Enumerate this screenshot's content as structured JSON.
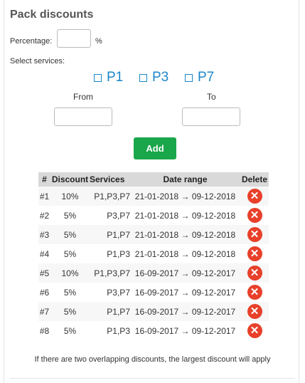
{
  "title": "Pack discounts",
  "percentage": {
    "label": "Percentage:",
    "value": "",
    "unit": "%"
  },
  "services": {
    "label": "Select services:",
    "options": [
      {
        "label": "P1",
        "checked": false
      },
      {
        "label": "P3",
        "checked": false
      },
      {
        "label": "P7",
        "checked": false
      }
    ]
  },
  "date": {
    "from_label": "From",
    "from_value": "",
    "to_label": "To",
    "to_value": ""
  },
  "add_label": "Add",
  "table": {
    "headers": [
      "#",
      "Discount",
      "Services",
      "Date range",
      "Delete"
    ],
    "rows": [
      {
        "num": "#1",
        "discount": "10%",
        "services": "P1,P3,P7",
        "range": "21-01-2018 → 09-12-2018"
      },
      {
        "num": "#2",
        "discount": "5%",
        "services": "P3,P7",
        "range": "21-01-2018 → 09-12-2018"
      },
      {
        "num": "#3",
        "discount": "5%",
        "services": "P1,P7",
        "range": "21-01-2018 → 09-12-2018"
      },
      {
        "num": "#4",
        "discount": "5%",
        "services": "P1,P3",
        "range": "21-01-2018 → 09-12-2018"
      },
      {
        "num": "#5",
        "discount": "10%",
        "services": "P1,P3,P7",
        "range": "16-09-2017 → 09-12-2017"
      },
      {
        "num": "#6",
        "discount": "5%",
        "services": "P3,P7",
        "range": "16-09-2017 → 09-12-2017"
      },
      {
        "num": "#7",
        "discount": "5%",
        "services": "P1,P7",
        "range": "16-09-2017 → 09-12-2017"
      },
      {
        "num": "#8",
        "discount": "5%",
        "services": "P1,P3",
        "range": "16-09-2017 → 09-12-2017"
      }
    ]
  },
  "note": "If there are two overlapping discounts, the largest discount will apply",
  "colors": {
    "accent": "#1a87c9",
    "add_button": "#1aa64a",
    "delete_icon": "#e8402a"
  },
  "icons": {
    "delete": "delete-icon"
  }
}
